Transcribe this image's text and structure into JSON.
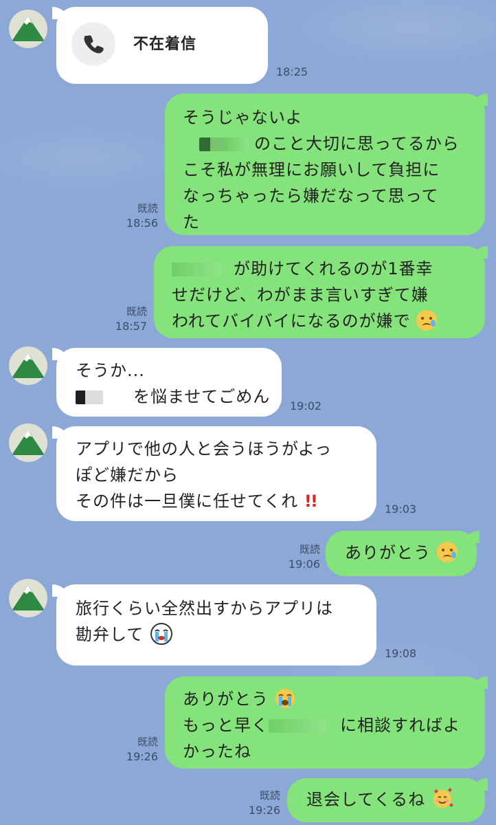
{
  "messages": {
    "m1": {
      "call_label": "不在着信",
      "time": "18:25"
    },
    "m2": {
      "lines": [
        "そうじゃないよ",
        "のこと大切に思ってるから",
        "こそ私が無理にお願いして負担に",
        "なっちゃったら嫌だなって思って",
        "た"
      ],
      "read": "既読",
      "time": "18:56"
    },
    "m3": {
      "lines": [
        "が助けてくれるのが1番幸",
        "せだけど、わがまま言いすぎて嫌",
        "われてバイバイになるのが嫌で"
      ],
      "read": "既読",
      "time": "18:57"
    },
    "m4": {
      "lines": [
        "そうか...",
        "を悩ませてごめん"
      ],
      "time": "19:02"
    },
    "m5": {
      "lines": [
        "アプリで他の人と会うほうがよっ",
        "ぽど嫌だから",
        "その件は一旦僕に任せてくれ"
      ],
      "exclaim": "!!",
      "time": "19:03"
    },
    "m6": {
      "lines": [
        "ありがとう"
      ],
      "read": "既読",
      "time": "19:06"
    },
    "m7": {
      "lines": [
        "旅行くらい全然出すからアプリは",
        "勘弁して"
      ],
      "time": "19:08"
    },
    "m8": {
      "lines": [
        "ありがとう",
        "もっと早く",
        "に相談すればよ",
        "かったね"
      ],
      "read": "既読",
      "time": "19:26"
    },
    "m9": {
      "lines": [
        "退会してくるね"
      ],
      "read": "既読",
      "time": "19:26"
    }
  },
  "colors": {
    "background": "#8ba8d6",
    "incoming": "#ffffff",
    "outgoing": "#85e37b"
  },
  "icons": [
    "avatar-mountain-icon",
    "phone-icon",
    "crying-face-icon",
    "loudly-crying-face-icon",
    "smiling-hearts-face-icon"
  ]
}
